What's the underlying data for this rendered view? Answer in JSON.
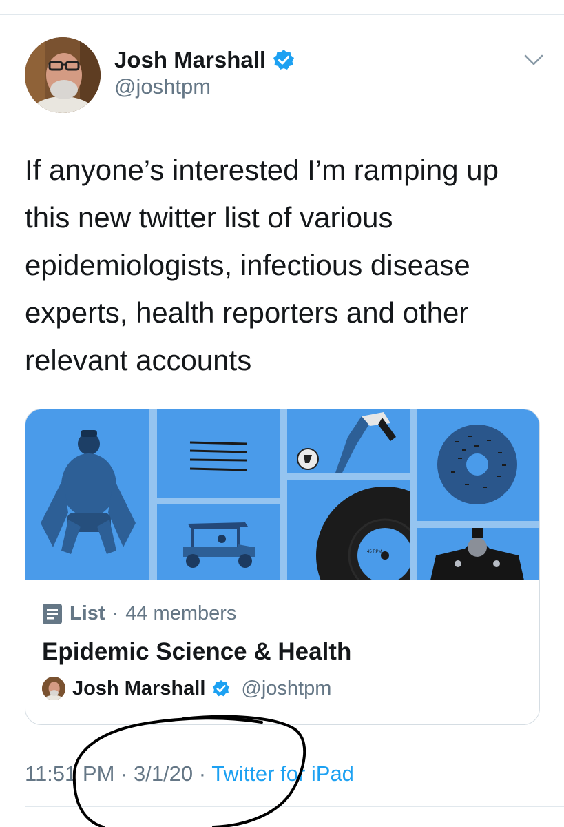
{
  "author": {
    "name": "Josh Marshall",
    "handle": "@joshtpm"
  },
  "tweet": {
    "text": "If anyone’s interested I’m ramping up this new twitter list of various epidemiologists, infectious disease experts, health reporters and other relevant accounts"
  },
  "card": {
    "type_label": "List",
    "separator": "·",
    "member_count": "44 members",
    "title": "Epidemic Science & Health",
    "owner_name": "Josh Marshall",
    "owner_handle": "@joshtpm",
    "media_record_label": "45 RPM"
  },
  "meta": {
    "time": "11:51 PM",
    "date": "3/1/20",
    "separator": "·",
    "source": "Twitter for iPad"
  },
  "colors": {
    "accent": "#1da1f2",
    "verified": "#1da1f2",
    "card_blue": "#4a9bea",
    "muted_text": "#657786",
    "annotation_ink": "#000000"
  },
  "icons": {
    "verified": "verified-badge-icon",
    "chevron": "chevron-down-icon",
    "list": "list-icon"
  }
}
